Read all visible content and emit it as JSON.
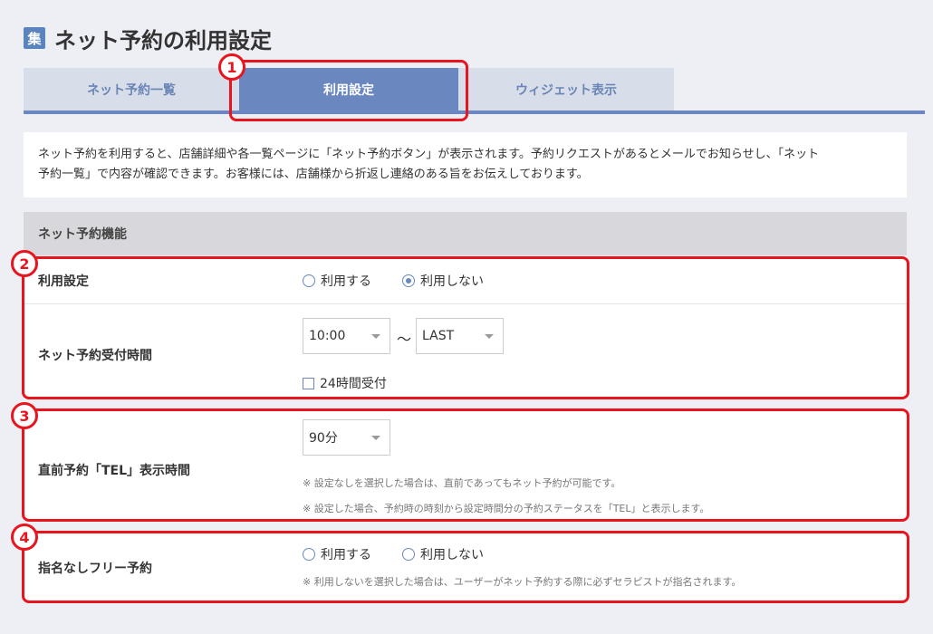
{
  "header": {
    "icon_label": "集",
    "title": "ネット予約の利用設定"
  },
  "tabs": [
    {
      "label": "ネット予約一覧",
      "active": false
    },
    {
      "label": "利用設定",
      "active": true
    },
    {
      "label": "ウィジェット表示",
      "active": false
    }
  ],
  "description": {
    "line1": "ネット予約を利用すると、店舗詳細や各一覧ページに「ネット予約ボタン」が表示されます。予約リクエストがあるとメールでお知らせし、「ネット",
    "line2": "予約一覧」で内容が確認できます。お客様には、店舗様から折返し連絡のある旨をお伝えしております。"
  },
  "section": {
    "title": "ネット予約機能"
  },
  "usage": {
    "label": "利用設定",
    "option_use": "利用する",
    "option_not_use": "利用しない",
    "selected": "利用しない"
  },
  "hours": {
    "label": "ネット予約受付時間",
    "start_value": "10:00",
    "separator": "〜",
    "end_value": "LAST",
    "all_day_label": "24時間受付",
    "all_day_checked": false
  },
  "tel_display": {
    "label": "直前予約「TEL」表示時間",
    "value": "90分",
    "note1": "※ 設定なしを選択した場合は、直前であってもネット予約が可能です。",
    "note2": "※ 設定した場合、予約時の時刻から設定時間分の予約ステータスを「TEL」と表示します。"
  },
  "free_booking": {
    "label": "指名なしフリー予約",
    "option_use": "利用する",
    "option_not_use": "利用しない",
    "note": "※ 利用しないを選択した場合は、ユーザーがネット予約する際に必ずセラピストが指名されます。"
  },
  "annotations": {
    "badge1": "1",
    "badge2": "2",
    "badge3": "3",
    "badge4": "4"
  },
  "colors": {
    "accent": "#6a88bf",
    "highlight": "#e8141e",
    "background": "#eeeff5"
  }
}
